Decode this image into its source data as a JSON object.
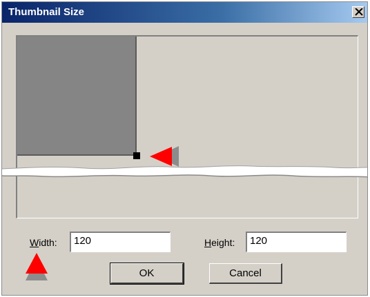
{
  "window": {
    "title": "Thumbnail Size"
  },
  "icons": {
    "close": "close-icon",
    "handle_arrow": "red-arrow-left-icon",
    "width_arrow": "red-arrow-up-icon"
  },
  "form": {
    "width_label_key": "W",
    "width_label_rest": "idth:",
    "width_value": "120",
    "height_label_key": "H",
    "height_label_rest": "eight:",
    "height_value": "120"
  },
  "buttons": {
    "ok": "OK",
    "cancel": "Cancel"
  },
  "colors": {
    "title_start": "#0a246a",
    "title_end": "#a6caf0",
    "dialog_bg": "#d4d0c8",
    "thumbnail": "#858585",
    "arrow": "#ff0000"
  }
}
